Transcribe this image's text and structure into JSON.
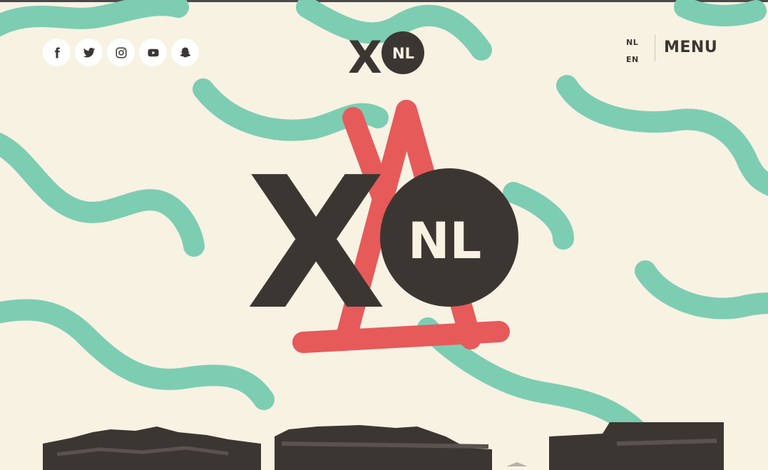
{
  "brand": {
    "logo_letter": "X",
    "logo_badge": "NL"
  },
  "colors": {
    "background": "#f8f2e3",
    "squiggle": "#7dcdb3",
    "brand_dark": "#3c3633",
    "accent_red": "#e65a5a"
  },
  "social": [
    {
      "name": "facebook",
      "icon": "facebook-icon"
    },
    {
      "name": "twitter",
      "icon": "twitter-icon"
    },
    {
      "name": "instagram",
      "icon": "instagram-icon"
    },
    {
      "name": "youtube",
      "icon": "youtube-icon"
    },
    {
      "name": "snapchat",
      "icon": "snapchat-icon"
    }
  ],
  "lang": {
    "nl": "NL",
    "en": "EN"
  },
  "menu_label": "MENU",
  "hero": {
    "letter": "X",
    "badge": "NL"
  }
}
